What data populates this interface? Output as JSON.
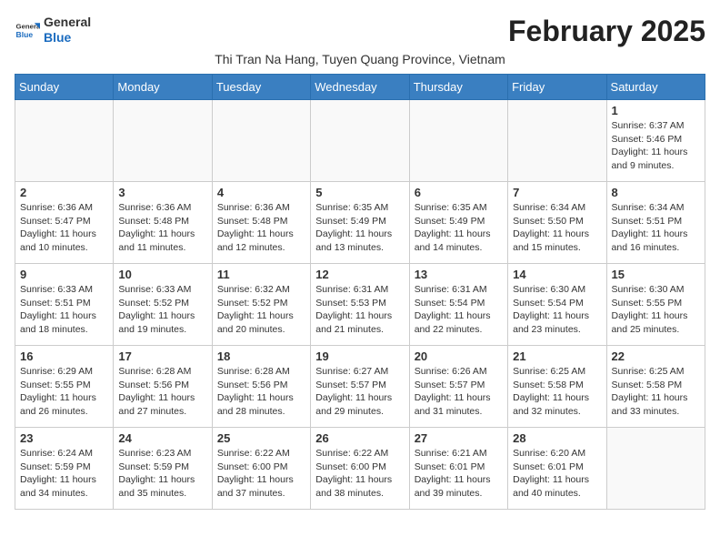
{
  "logo": {
    "general": "General",
    "blue": "Blue"
  },
  "title": "February 2025",
  "subtitle": "Thi Tran Na Hang, Tuyen Quang Province, Vietnam",
  "days_of_week": [
    "Sunday",
    "Monday",
    "Tuesday",
    "Wednesday",
    "Thursday",
    "Friday",
    "Saturday"
  ],
  "weeks": [
    [
      {
        "day": null
      },
      {
        "day": null
      },
      {
        "day": null
      },
      {
        "day": null
      },
      {
        "day": null
      },
      {
        "day": null
      },
      {
        "day": "1",
        "info": "Sunrise: 6:37 AM\nSunset: 5:46 PM\nDaylight: 11 hours and 9 minutes."
      }
    ],
    [
      {
        "day": "2",
        "info": "Sunrise: 6:36 AM\nSunset: 5:47 PM\nDaylight: 11 hours and 10 minutes."
      },
      {
        "day": "3",
        "info": "Sunrise: 6:36 AM\nSunset: 5:48 PM\nDaylight: 11 hours and 11 minutes."
      },
      {
        "day": "4",
        "info": "Sunrise: 6:36 AM\nSunset: 5:48 PM\nDaylight: 11 hours and 12 minutes."
      },
      {
        "day": "5",
        "info": "Sunrise: 6:35 AM\nSunset: 5:49 PM\nDaylight: 11 hours and 13 minutes."
      },
      {
        "day": "6",
        "info": "Sunrise: 6:35 AM\nSunset: 5:49 PM\nDaylight: 11 hours and 14 minutes."
      },
      {
        "day": "7",
        "info": "Sunrise: 6:34 AM\nSunset: 5:50 PM\nDaylight: 11 hours and 15 minutes."
      },
      {
        "day": "8",
        "info": "Sunrise: 6:34 AM\nSunset: 5:51 PM\nDaylight: 11 hours and 16 minutes."
      }
    ],
    [
      {
        "day": "9",
        "info": "Sunrise: 6:33 AM\nSunset: 5:51 PM\nDaylight: 11 hours and 18 minutes."
      },
      {
        "day": "10",
        "info": "Sunrise: 6:33 AM\nSunset: 5:52 PM\nDaylight: 11 hours and 19 minutes."
      },
      {
        "day": "11",
        "info": "Sunrise: 6:32 AM\nSunset: 5:52 PM\nDaylight: 11 hours and 20 minutes."
      },
      {
        "day": "12",
        "info": "Sunrise: 6:31 AM\nSunset: 5:53 PM\nDaylight: 11 hours and 21 minutes."
      },
      {
        "day": "13",
        "info": "Sunrise: 6:31 AM\nSunset: 5:54 PM\nDaylight: 11 hours and 22 minutes."
      },
      {
        "day": "14",
        "info": "Sunrise: 6:30 AM\nSunset: 5:54 PM\nDaylight: 11 hours and 23 minutes."
      },
      {
        "day": "15",
        "info": "Sunrise: 6:30 AM\nSunset: 5:55 PM\nDaylight: 11 hours and 25 minutes."
      }
    ],
    [
      {
        "day": "16",
        "info": "Sunrise: 6:29 AM\nSunset: 5:55 PM\nDaylight: 11 hours and 26 minutes."
      },
      {
        "day": "17",
        "info": "Sunrise: 6:28 AM\nSunset: 5:56 PM\nDaylight: 11 hours and 27 minutes."
      },
      {
        "day": "18",
        "info": "Sunrise: 6:28 AM\nSunset: 5:56 PM\nDaylight: 11 hours and 28 minutes."
      },
      {
        "day": "19",
        "info": "Sunrise: 6:27 AM\nSunset: 5:57 PM\nDaylight: 11 hours and 29 minutes."
      },
      {
        "day": "20",
        "info": "Sunrise: 6:26 AM\nSunset: 5:57 PM\nDaylight: 11 hours and 31 minutes."
      },
      {
        "day": "21",
        "info": "Sunrise: 6:25 AM\nSunset: 5:58 PM\nDaylight: 11 hours and 32 minutes."
      },
      {
        "day": "22",
        "info": "Sunrise: 6:25 AM\nSunset: 5:58 PM\nDaylight: 11 hours and 33 minutes."
      }
    ],
    [
      {
        "day": "23",
        "info": "Sunrise: 6:24 AM\nSunset: 5:59 PM\nDaylight: 11 hours and 34 minutes."
      },
      {
        "day": "24",
        "info": "Sunrise: 6:23 AM\nSunset: 5:59 PM\nDaylight: 11 hours and 35 minutes."
      },
      {
        "day": "25",
        "info": "Sunrise: 6:22 AM\nSunset: 6:00 PM\nDaylight: 11 hours and 37 minutes."
      },
      {
        "day": "26",
        "info": "Sunrise: 6:22 AM\nSunset: 6:00 PM\nDaylight: 11 hours and 38 minutes."
      },
      {
        "day": "27",
        "info": "Sunrise: 6:21 AM\nSunset: 6:01 PM\nDaylight: 11 hours and 39 minutes."
      },
      {
        "day": "28",
        "info": "Sunrise: 6:20 AM\nSunset: 6:01 PM\nDaylight: 11 hours and 40 minutes."
      },
      {
        "day": null
      }
    ]
  ]
}
